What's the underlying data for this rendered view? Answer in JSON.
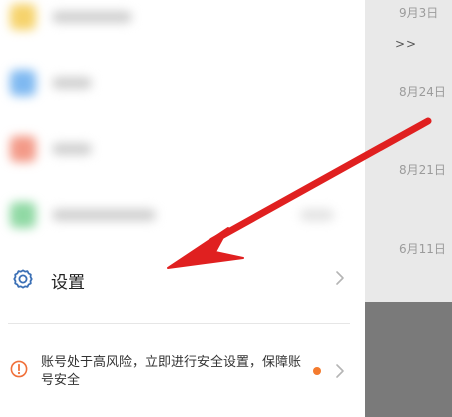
{
  "background_list": {
    "dates": [
      "9月3日",
      "8月24日",
      "8月21日",
      "6月11日"
    ],
    "more_marker": ">>"
  },
  "blurred_items": {
    "icon_colors": [
      "#f6d36c",
      "#7fb9f1",
      "#f39a88",
      "#90d9a4"
    ]
  },
  "settings": {
    "icon": "gear-icon",
    "label": "设置"
  },
  "warning": {
    "icon": "alert-circle-icon",
    "text": "账号处于高风险，立即进行安全设置，保障账号安全",
    "dot_color": "#f47b2e"
  },
  "annotation": {
    "arrow_color": "#e02020"
  }
}
